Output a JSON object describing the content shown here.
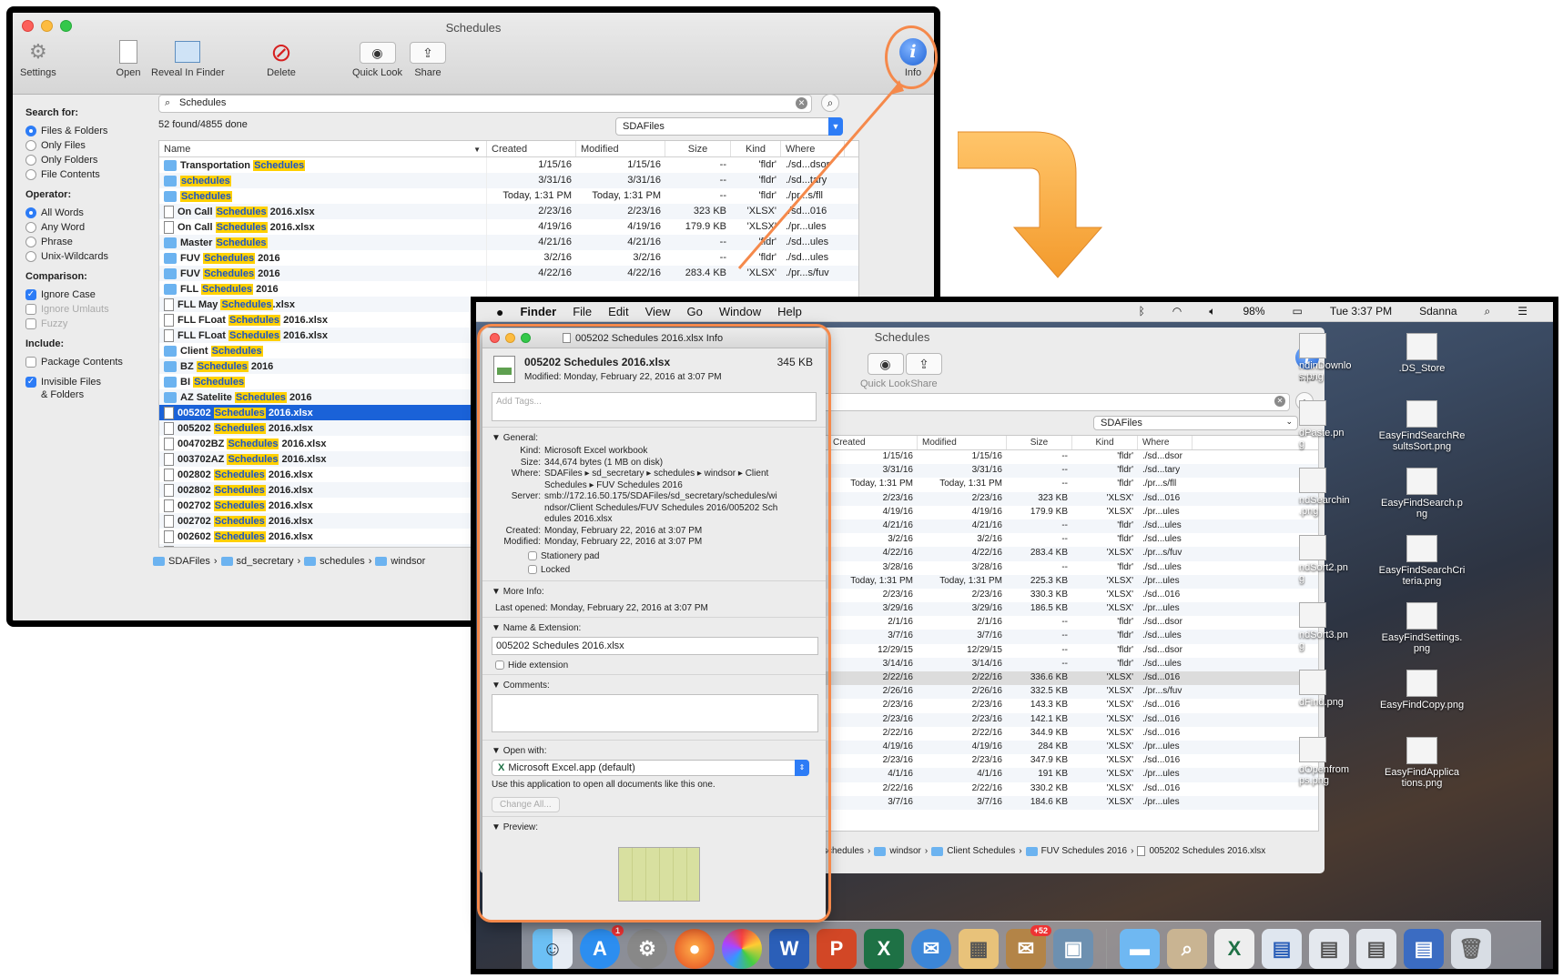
{
  "win1": {
    "title": "Schedules",
    "toolbar": {
      "settings": "Settings",
      "open": "Open",
      "reveal": "Reveal In Finder",
      "delete": "Delete",
      "quicklook": "Quick Look",
      "share": "Share",
      "info": "Info"
    },
    "sidebar": {
      "search_for": "Search for:",
      "opts_search": [
        "Files & Folders",
        "Only Files",
        "Only Folders",
        "File Contents"
      ],
      "operator": "Operator:",
      "opts_operator": [
        "All Words",
        "Any Word",
        "Phrase",
        "Unix-Wildcards"
      ],
      "comparison": "Comparison:",
      "opts_comparison": [
        "Ignore Case",
        "Ignore Umlauts",
        "Fuzzy"
      ],
      "include": "Include:",
      "opts_include": [
        "Package Contents",
        "Invisible Files",
        "& Folders"
      ]
    },
    "search_value": "Schedules",
    "found": "52 found/4855 done",
    "scope": "SDAFiles",
    "columns": [
      "Name",
      "Created",
      "Modified",
      "Size",
      "Kind",
      "Where"
    ],
    "rows": [
      {
        "pre": "Transportation ",
        "hl": "Schedules",
        "post": "",
        "t": "f",
        "c": "1/15/16",
        "m": "1/15/16",
        "s": "--",
        "k": "'fldr'",
        "w": "./sd...dsor"
      },
      {
        "pre": "",
        "hl": "schedules",
        "post": "",
        "t": "f",
        "c": "3/31/16",
        "m": "3/31/16",
        "s": "--",
        "k": "'fldr'",
        "w": "./sd...tary"
      },
      {
        "pre": "",
        "hl": "Schedules",
        "post": "",
        "t": "f",
        "c": "Today, 1:31 PM",
        "m": "Today, 1:31 PM",
        "s": "--",
        "k": "'fldr'",
        "w": "./pr...s/fll"
      },
      {
        "pre": "On Call ",
        "hl": "Schedules",
        "post": " 2016.xlsx",
        "t": "x",
        "c": "2/23/16",
        "m": "2/23/16",
        "s": "323 KB",
        "k": "'XLSX'",
        "w": "./sd...016"
      },
      {
        "pre": "On Call ",
        "hl": "Schedules",
        "post": " 2016.xlsx",
        "t": "x",
        "c": "4/19/16",
        "m": "4/19/16",
        "s": "179.9 KB",
        "k": "'XLSX'",
        "w": "./pr...ules"
      },
      {
        "pre": "Master ",
        "hl": "Schedules",
        "post": "",
        "t": "f",
        "c": "4/21/16",
        "m": "4/21/16",
        "s": "--",
        "k": "'fldr'",
        "w": "./sd...ules"
      },
      {
        "pre": "FUV ",
        "hl": "Schedules",
        "post": " 2016",
        "t": "f",
        "c": "3/2/16",
        "m": "3/2/16",
        "s": "--",
        "k": "'fldr'",
        "w": "./sd...ules"
      },
      {
        "pre": "FUV ",
        "hl": "Schedules",
        "post": " 2016",
        "t": "f",
        "c": "4/22/16",
        "m": "4/22/16",
        "s": "283.4 KB",
        "k": "'XLSX'",
        "w": "./pr...s/fuv"
      },
      {
        "pre": "FLL ",
        "hl": "Schedules",
        "post": " 2016",
        "t": "f"
      },
      {
        "pre": "FLL May ",
        "hl": "Schedules",
        "post": ".xlsx",
        "t": "x"
      },
      {
        "pre": "FLL FLoat ",
        "hl": "Schedules",
        "post": " 2016.xlsx",
        "t": "x"
      },
      {
        "pre": "FLL FLoat ",
        "hl": "Schedules",
        "post": " 2016.xlsx",
        "t": "x"
      },
      {
        "pre": "Client ",
        "hl": "Schedules",
        "post": "",
        "t": "f"
      },
      {
        "pre": "BZ ",
        "hl": "Schedules",
        "post": " 2016",
        "t": "f"
      },
      {
        "pre": "BI ",
        "hl": "Schedules",
        "post": "",
        "t": "f"
      },
      {
        "pre": "AZ Satelite ",
        "hl": "Schedules",
        "post": " 2016",
        "t": "f"
      },
      {
        "pre": "005202 ",
        "hl": "Schedules",
        "post": " 2016.xlsx",
        "t": "x",
        "sel": true
      },
      {
        "pre": "005202 ",
        "hl": "Schedules",
        "post": " 2016.xlsx",
        "t": "x"
      },
      {
        "pre": "004702BZ ",
        "hl": "Schedules",
        "post": " 2016.xlsx",
        "t": "x"
      },
      {
        "pre": "003702AZ ",
        "hl": "Schedules",
        "post": " 2016.xlsx",
        "t": "x"
      },
      {
        "pre": "002802 ",
        "hl": "Schedules",
        "post": " 2016.xlsx",
        "t": "x"
      },
      {
        "pre": "002802 ",
        "hl": "Schedules",
        "post": " 2016.xlsx",
        "t": "x"
      },
      {
        "pre": "002702 ",
        "hl": "Schedules",
        "post": " 2016.xlsx",
        "t": "x"
      },
      {
        "pre": "002702 ",
        "hl": "Schedules",
        "post": " 2016.xlsx",
        "t": "x"
      },
      {
        "pre": "002602 ",
        "hl": "Schedules",
        "post": " 2016.xlsx",
        "t": "x"
      },
      {
        "pre": "002602 ",
        "hl": "Schedules",
        "post": " 2016.xlsx",
        "t": "x"
      }
    ],
    "path": [
      "SDAFiles",
      "sd_secretary",
      "schedules",
      "windsor"
    ]
  },
  "win2": {
    "menu": [
      "Finder",
      "File",
      "Edit",
      "View",
      "Go",
      "Window",
      "Help"
    ],
    "status": {
      "battery": "98%",
      "time": "Tue 3:37 PM",
      "user": "Sdanna"
    },
    "title": "Schedules",
    "toolbar": {
      "quicklook": "Quick Look",
      "share": "Share",
      "info": "Info"
    },
    "scope": "SDAFiles",
    "columns": [
      "Created",
      "Modified",
      "Size",
      "Kind",
      "Where"
    ],
    "rows": [
      {
        "n": "es",
        "c": "1/15/16",
        "m": "1/15/16",
        "s": "--",
        "k": "'fldr'",
        "w": "./sd...dsor"
      },
      {
        "n": "",
        "c": "3/31/16",
        "m": "3/31/16",
        "s": "--",
        "k": "'fldr'",
        "w": "./sd...tary"
      },
      {
        "n": "",
        "c": "Today, 1:31 PM",
        "m": "Today, 1:31 PM",
        "s": "--",
        "k": "'fldr'",
        "w": "./pr...s/fll"
      },
      {
        "n": "6.xlsx",
        "c": "2/23/16",
        "m": "2/23/16",
        "s": "323 KB",
        "k": "'XLSX'",
        "w": "./sd...016"
      },
      {
        "n": "6.xlsx",
        "c": "4/19/16",
        "m": "4/19/16",
        "s": "179.9 KB",
        "k": "'XLSX'",
        "w": "./pr...ules"
      },
      {
        "n": "",
        "c": "4/21/16",
        "m": "4/21/16",
        "s": "--",
        "k": "'fldr'",
        "w": "./sd...ules"
      },
      {
        "n": "",
        "c": "3/2/16",
        "m": "3/2/16",
        "s": "--",
        "k": "'fldr'",
        "w": "./sd...ules"
      },
      {
        "n": "",
        "c": "4/22/16",
        "m": "4/22/16",
        "s": "283.4 KB",
        "k": "'XLSX'",
        "w": "./pr...s/fuv"
      },
      {
        "n": "",
        "c": "3/28/16",
        "m": "3/28/16",
        "s": "--",
        "k": "'fldr'",
        "w": "./sd...ules"
      },
      {
        "n": "",
        "c": "Today, 1:31 PM",
        "m": "Today, 1:31 PM",
        "s": "225.3 KB",
        "k": "'XLSX'",
        "w": "./pr...ules"
      },
      {
        "n": "016.xlsx",
        "c": "2/23/16",
        "m": "2/23/16",
        "s": "330.3 KB",
        "k": "'XLSX'",
        "w": "./sd...016"
      },
      {
        "n": "016.xlsx",
        "c": "3/29/16",
        "m": "3/29/16",
        "s": "186.5 KB",
        "k": "'XLSX'",
        "w": "./pr...ules"
      },
      {
        "n": "",
        "c": "2/1/16",
        "m": "2/1/16",
        "s": "--",
        "k": "'fldr'",
        "w": "./sd...dsor"
      },
      {
        "n": "",
        "c": "3/7/16",
        "m": "3/7/16",
        "s": "--",
        "k": "'fldr'",
        "w": "./sd...ules"
      },
      {
        "n": "",
        "c": "12/29/15",
        "m": "12/29/15",
        "s": "--",
        "k": "'fldr'",
        "w": "./sd...dsor"
      },
      {
        "n": "2016",
        "c": "3/14/16",
        "m": "3/14/16",
        "s": "--",
        "k": "'fldr'",
        "w": "./sd...ules"
      },
      {
        "n": "16.xlsx",
        "c": "2/22/16",
        "m": "2/22/16",
        "s": "336.6 KB",
        "k": "'XLSX'",
        "w": "./sd...016",
        "sel": true
      },
      {
        "n": "16.xlsx",
        "c": "2/26/16",
        "m": "2/26/16",
        "s": "332.5 KB",
        "k": "'XLSX'",
        "w": "./pr...s/fuv"
      },
      {
        "n": "2016.xlsx",
        "c": "2/23/16",
        "m": "2/23/16",
        "s": "143.3 KB",
        "k": "'XLSX'",
        "w": "./sd...016"
      },
      {
        "n": "2016.xlsx",
        "c": "2/23/16",
        "m": "2/23/16",
        "s": "142.1 KB",
        "k": "'XLSX'",
        "w": "./sd...016"
      },
      {
        "n": "16.xlsx",
        "c": "2/22/16",
        "m": "2/22/16",
        "s": "344.9 KB",
        "k": "'XLSX'",
        "w": "./sd...016"
      },
      {
        "n": "16.xlsx",
        "c": "4/19/16",
        "m": "4/19/16",
        "s": "284 KB",
        "k": "'XLSX'",
        "w": "./pr...ules"
      },
      {
        "n": "16.xlsx",
        "c": "2/23/16",
        "m": "2/23/16",
        "s": "347.9 KB",
        "k": "'XLSX'",
        "w": "./sd...016"
      },
      {
        "n": "16.xlsx",
        "c": "4/1/16",
        "m": "4/1/16",
        "s": "191 KB",
        "k": "'XLSX'",
        "w": "./pr...ules"
      },
      {
        "n": "16.xlsx",
        "c": "2/22/16",
        "m": "2/22/16",
        "s": "330.2 KB",
        "k": "'XLSX'",
        "w": "./sd...016"
      },
      {
        "n": "16.xlsx",
        "c": "3/7/16",
        "m": "3/7/16",
        "s": "184.6 KB",
        "k": "'XLSX'",
        "w": "./pr...ules"
      }
    ],
    "path": [
      "schedules",
      "windsor",
      "Client Schedules",
      "FUV Schedules 2016",
      "005202 Schedules 2016.xlsx"
    ],
    "desktop": [
      {
        "a": "ndinDownlo",
        "b": "s.png",
        "c": ".DS_Store",
        "d": ""
      },
      {
        "a": "dPaste.pn",
        "b": "g",
        "c": "EasyFindSearchRe",
        "d": "sultsSort.png"
      },
      {
        "a": "ndSearchin",
        "b": ".png",
        "c": "EasyFindSearch.p",
        "d": "ng"
      },
      {
        "a": "ndSort2.pn",
        "b": "g",
        "c": "EasyFindSearchCri",
        "d": "teria.png"
      },
      {
        "a": "ndSort3.pn",
        "b": "g",
        "c": "EasyFindSettings.",
        "d": "png"
      },
      {
        "a": "dFind.png",
        "b": "",
        "c": "EasyFindCopy.png",
        "d": ""
      },
      {
        "a": "dOpenfrom",
        "b": "ps.png",
        "c": "EasyFindApplica",
        "d": "tions.png"
      }
    ],
    "dock_badges": {
      "appstore": "1",
      "mail": "+52"
    }
  },
  "info": {
    "title": "005202 Schedules 2016.xlsx Info",
    "name": "005202 Schedules 2016.xlsx",
    "size": "345 KB",
    "modified": "Modified: Monday, February 22, 2016 at 3:07 PM",
    "tags_placeholder": "Add Tags...",
    "general": "General:",
    "kind_k": "Kind:",
    "kind_v": "Microsoft Excel workbook",
    "size_k": "Size:",
    "size_v": "344,674 bytes (1 MB on disk)",
    "where_k": "Where:",
    "where_v": "SDAFiles ▸ sd_secretary ▸ schedules ▸ windsor ▸ Client Schedules ▸ FUV Schedules 2016",
    "server_k": "Server:",
    "server_v": "smb://172.16.50.175/SDAFiles/sd_secretary/schedules/windsor/Client Schedules/FUV Schedules 2016/005202 Schedules 2016.xlsx",
    "created_k": "Created:",
    "created_v": "Monday, February 22, 2016 at 3:07 PM",
    "modified_k": "Modified:",
    "modified_v": "Monday, February 22, 2016 at 3:07 PM",
    "stationery": "Stationery pad",
    "locked": "Locked",
    "more_info": "More Info:",
    "last_opened": "Last opened: Monday, February 22, 2016 at 3:07 PM",
    "name_ext": "Name & Extension:",
    "filename": "005202 Schedules 2016.xlsx",
    "hide_ext": "Hide extension",
    "comments": "Comments:",
    "open_with": "Open with:",
    "app": "Microsoft Excel.app (default)",
    "app_note": "Use this application to open all documents like this one.",
    "change_all": "Change All...",
    "preview": "Preview:"
  },
  "colors": {
    "accent": "#2d7cf6",
    "highlight": "#ffd000",
    "annotation": "#f5894b",
    "selection": "#1a62d8"
  }
}
